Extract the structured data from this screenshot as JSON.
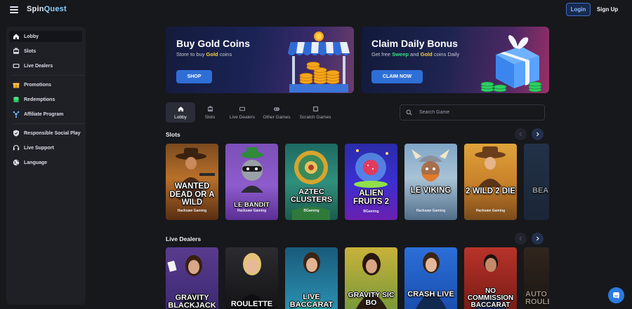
{
  "header": {
    "logo_text": "Spin",
    "logo_accent": "Quest",
    "login_label": "Login",
    "signup_label": "Sign Up"
  },
  "sidebar": {
    "items": [
      {
        "label": "Lobby",
        "icon": "home-icon"
      },
      {
        "label": "Slots",
        "icon": "slot-machine-icon"
      },
      {
        "label": "Live Dealers",
        "icon": "tv-icon"
      },
      {
        "label": "Promotions",
        "icon": "gift-icon"
      },
      {
        "label": "Redemptions",
        "icon": "coins-icon"
      },
      {
        "label": "Affiliate Program",
        "icon": "affiliate-icon"
      },
      {
        "label": "Responsible Social Play",
        "icon": "shield-icon"
      },
      {
        "label": "Live Support",
        "icon": "headset-icon"
      },
      {
        "label": "Language",
        "icon": "globe-icon"
      }
    ]
  },
  "banners": {
    "gold": {
      "title": "Buy Gold Coins",
      "sub_prefix": "Store to buy ",
      "sub_highlight": "Gold",
      "sub_suffix": " coins",
      "button": "SHOP"
    },
    "daily": {
      "title": "Claim Daily Bonus",
      "sub_prefix": "Get free ",
      "sub_highlight1": "Sweep",
      "sub_mid": " and ",
      "sub_highlight2": "Gold",
      "sub_suffix": " coins Daily",
      "button": "CLAIM NOW"
    }
  },
  "tabs": [
    {
      "label": "Lobby",
      "icon": "home-icon",
      "active": true
    },
    {
      "label": "Slots",
      "icon": "slot-machine-icon"
    },
    {
      "label": "Live Dealers",
      "icon": "tv-icon"
    },
    {
      "label": "Other Games",
      "icon": "gamepad-icon"
    },
    {
      "label": "Scratch Games",
      "icon": "scratch-card-icon"
    }
  ],
  "search": {
    "placeholder": "Search Game"
  },
  "sections": {
    "slots": {
      "title": "Slots",
      "games": [
        {
          "title": "Wanted Dead or a Wild",
          "provider": "Hacksaw Gaming"
        },
        {
          "title": "Le Bandit",
          "provider": "Hacksaw Gaming"
        },
        {
          "title": "Aztec Clusters",
          "provider": "BGaming"
        },
        {
          "title": "Alien Fruits 2",
          "provider": "BGaming"
        },
        {
          "title": "Le Viking",
          "provider": "Hacksaw Gaming"
        },
        {
          "title": "2 Wild 2 Die",
          "provider": "Hacksaw Gaming"
        },
        {
          "title": "Bea Bo",
          "provider": ""
        }
      ]
    },
    "live": {
      "title": "Live Dealers",
      "games": [
        {
          "title": "Gravity Blackjack"
        },
        {
          "title": "Roulette"
        },
        {
          "title": "Live Baccarat"
        },
        {
          "title": "Gravity Sic Bo"
        },
        {
          "title": "Crash Live"
        },
        {
          "title": "No Commission Baccarat"
        },
        {
          "title": "Auto Roulette"
        }
      ]
    }
  },
  "colors": {
    "background": "#17181c",
    "sidebar": "#1f2026",
    "accent_blue": "#2e6fd6",
    "gold": "#ffd13a",
    "green": "#33e27a"
  }
}
